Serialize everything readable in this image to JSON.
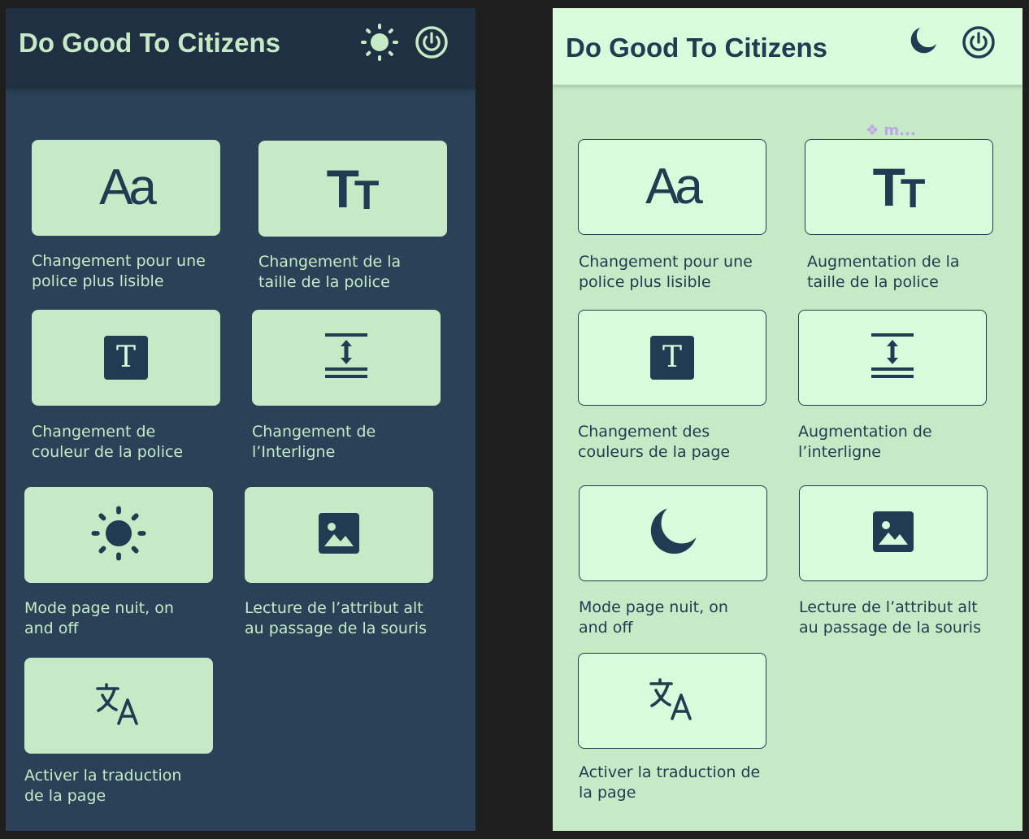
{
  "app": {
    "title": "Do Good To Citizens"
  },
  "dark_panel": {
    "header": {
      "theme_icon": "sun-icon",
      "power_icon": "power-icon"
    },
    "cards": [
      {
        "icon": "font-aa-icon",
        "label": "Changement pour une\npolice plus lisible"
      },
      {
        "icon": "text-size-icon",
        "label": "Changement de la\ntaille de la police"
      },
      {
        "icon": "text-color-icon",
        "label": "Changement de\ncouleur de la police"
      },
      {
        "icon": "line-spacing-icon",
        "label": "Changement de\nl’Interligne"
      },
      {
        "icon": "sun-icon",
        "label": "Mode page nuit, on\nand off"
      },
      {
        "icon": "image-icon",
        "label": "Lecture de l’attribut alt\nau passage de la souris"
      },
      {
        "icon": "translate-icon",
        "label": "Activer la traduction\nde la page"
      }
    ]
  },
  "light_panel": {
    "header": {
      "theme_icon": "moon-icon",
      "power_icon": "power-icon"
    },
    "component_badge": "❖ m...",
    "cards": [
      {
        "icon": "font-aa-icon",
        "label": "Changement pour une\npolice plus lisible"
      },
      {
        "icon": "text-size-icon",
        "label": "Augmentation de la\ntaille de la police"
      },
      {
        "icon": "text-color-icon",
        "label": "Changement des\ncouleurs de la page"
      },
      {
        "icon": "line-spacing-icon",
        "label": "Augmentation de\nl’interligne"
      },
      {
        "icon": "moon-icon",
        "label": "Mode page nuit, on\nand off"
      },
      {
        "icon": "image-icon",
        "label": "Lecture de l’attribut alt\nau passage de la souris"
      },
      {
        "icon": "translate-icon",
        "label": "Activer la traduction de\nla page"
      }
    ]
  },
  "colors": {
    "dark_bg": "#2a4157",
    "dark_header": "#1f3043",
    "mint": "#c6eac6",
    "mint_light": "#d9fadb",
    "navy": "#233b52",
    "outer_bg": "#1e1e1e"
  },
  "glyphs": {
    "aa": "Aa",
    "t_big": "T",
    "t_small": "T",
    "t_box": "T"
  }
}
